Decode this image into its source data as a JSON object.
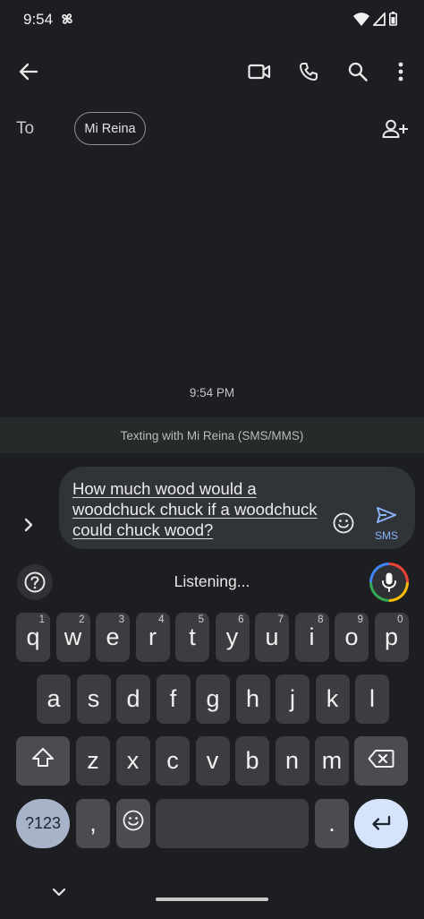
{
  "status_bar": {
    "time": "9:54"
  },
  "app_bar": {
    "back_icon": "arrow-left-icon",
    "actions": [
      "video-call-icon",
      "phone-icon",
      "search-icon",
      "more-vert-icon"
    ]
  },
  "recipient": {
    "to_label": "To",
    "chip": "Mi Reina",
    "add_icon": "add-person-icon"
  },
  "conversation": {
    "timestamp": "9:54 PM",
    "banner": "Texting with Mi Reina (SMS/MMS)"
  },
  "compose": {
    "text": "How much wood would a woodchuck chuck if a woodchuck could chuck wood?",
    "send_label": "SMS"
  },
  "keyboard": {
    "status": "Listening...",
    "row1": [
      {
        "k": "q",
        "h": "1"
      },
      {
        "k": "w",
        "h": "2"
      },
      {
        "k": "e",
        "h": "3"
      },
      {
        "k": "r",
        "h": "4"
      },
      {
        "k": "t",
        "h": "5"
      },
      {
        "k": "y",
        "h": "6"
      },
      {
        "k": "u",
        "h": "7"
      },
      {
        "k": "i",
        "h": "8"
      },
      {
        "k": "o",
        "h": "9"
      },
      {
        "k": "p",
        "h": "0"
      }
    ],
    "row2": [
      "a",
      "s",
      "d",
      "f",
      "g",
      "h",
      "j",
      "k",
      "l"
    ],
    "row3": [
      "z",
      "x",
      "c",
      "v",
      "b",
      "n",
      "m"
    ],
    "symbols_label": "?123",
    "comma": ",",
    "period": "."
  },
  "colors": {
    "background": "#1d1e22",
    "key": "#3c3d41",
    "accent": "#8ab4f8",
    "enter_key": "#d6e4fb",
    "symbols_key": "#a7b3c9"
  }
}
